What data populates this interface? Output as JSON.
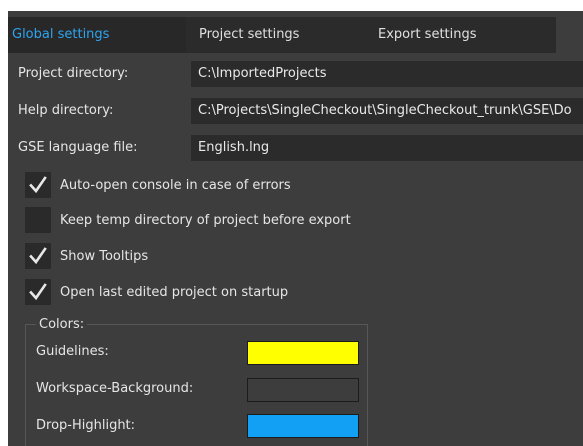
{
  "tabs": [
    {
      "label": "Global settings",
      "active": true
    },
    {
      "label": "Project settings",
      "active": false
    },
    {
      "label": "Export settings",
      "active": false
    }
  ],
  "fields": {
    "project_directory": {
      "label": "Project directory:",
      "value": "C:\\ImportedProjects"
    },
    "help_directory": {
      "label": "Help directory:",
      "value": "C:\\Projects\\SingleCheckout\\SingleCheckout_trunk\\GSE\\Do"
    },
    "language_file": {
      "label": "GSE language file:",
      "value": "English.lng"
    }
  },
  "options": [
    {
      "label": "Auto-open console in case of errors",
      "checked": true
    },
    {
      "label": "Keep temp directory of project before export",
      "checked": false
    },
    {
      "label": "Show Tooltips",
      "checked": true
    },
    {
      "label": "Open last edited project on startup",
      "checked": true
    }
  ],
  "colors": {
    "title": "Colors:",
    "items": [
      {
        "label": "Guidelines:",
        "color": "#ffff00"
      },
      {
        "label": "Workspace-Background:",
        "color": "#3d3d3d"
      },
      {
        "label": "Drop-Highlight:",
        "color": "#12a0f4"
      }
    ]
  },
  "theme": {
    "accent": "#2ea4f0",
    "background": "#3d3d3d",
    "field_background": "#2b2b2b"
  }
}
